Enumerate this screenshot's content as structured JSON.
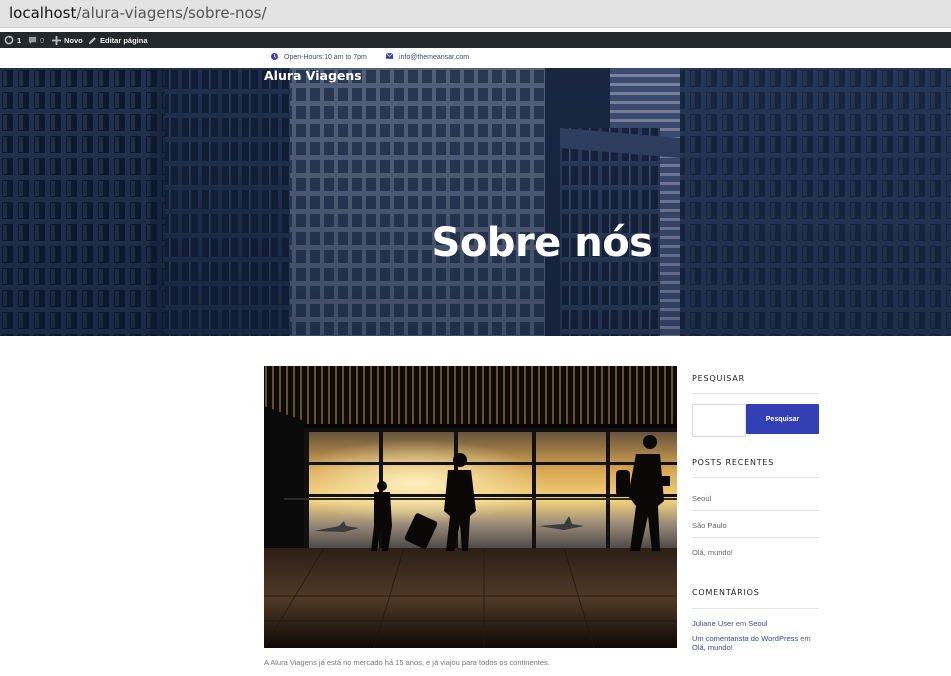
{
  "browser": {
    "url_host": "localhost",
    "url_path": "/alura-viagens/sobre-nos/"
  },
  "adminbar": {
    "updates_count": "1",
    "comments_count": "0",
    "new_label": "Novo",
    "edit_label": "Editar página"
  },
  "topinfo": {
    "hours": "Open-Hours:10 am to 7pm",
    "email": "info@themeansar.com"
  },
  "hero": {
    "site_title": "Alura Viagens",
    "page_title": "Sobre nós"
  },
  "content": {
    "caption": "A Alura Viagens já está no mercado há 15 anos, e já viajou para todos os continentes."
  },
  "sidebar": {
    "search_title": "PESQUISAR",
    "search_value": "",
    "search_button": "Pesquisar",
    "recent_title": "POSTS RECENTES",
    "recent_posts": [
      "Seoul",
      "São Paulo",
      "Olá, mundo!"
    ],
    "comments_title": "COMENTÁRIOS",
    "comments": [
      {
        "author": "Juliane User",
        "sep": "em",
        "post": "Seoul"
      },
      {
        "author": "Um comentarista do WordPress",
        "sep": "em",
        "post": "Olá, mundo!"
      }
    ]
  },
  "colors": {
    "adminbar_bg": "#23282d",
    "accent": "#3340b5",
    "link": "#3e47a8"
  }
}
